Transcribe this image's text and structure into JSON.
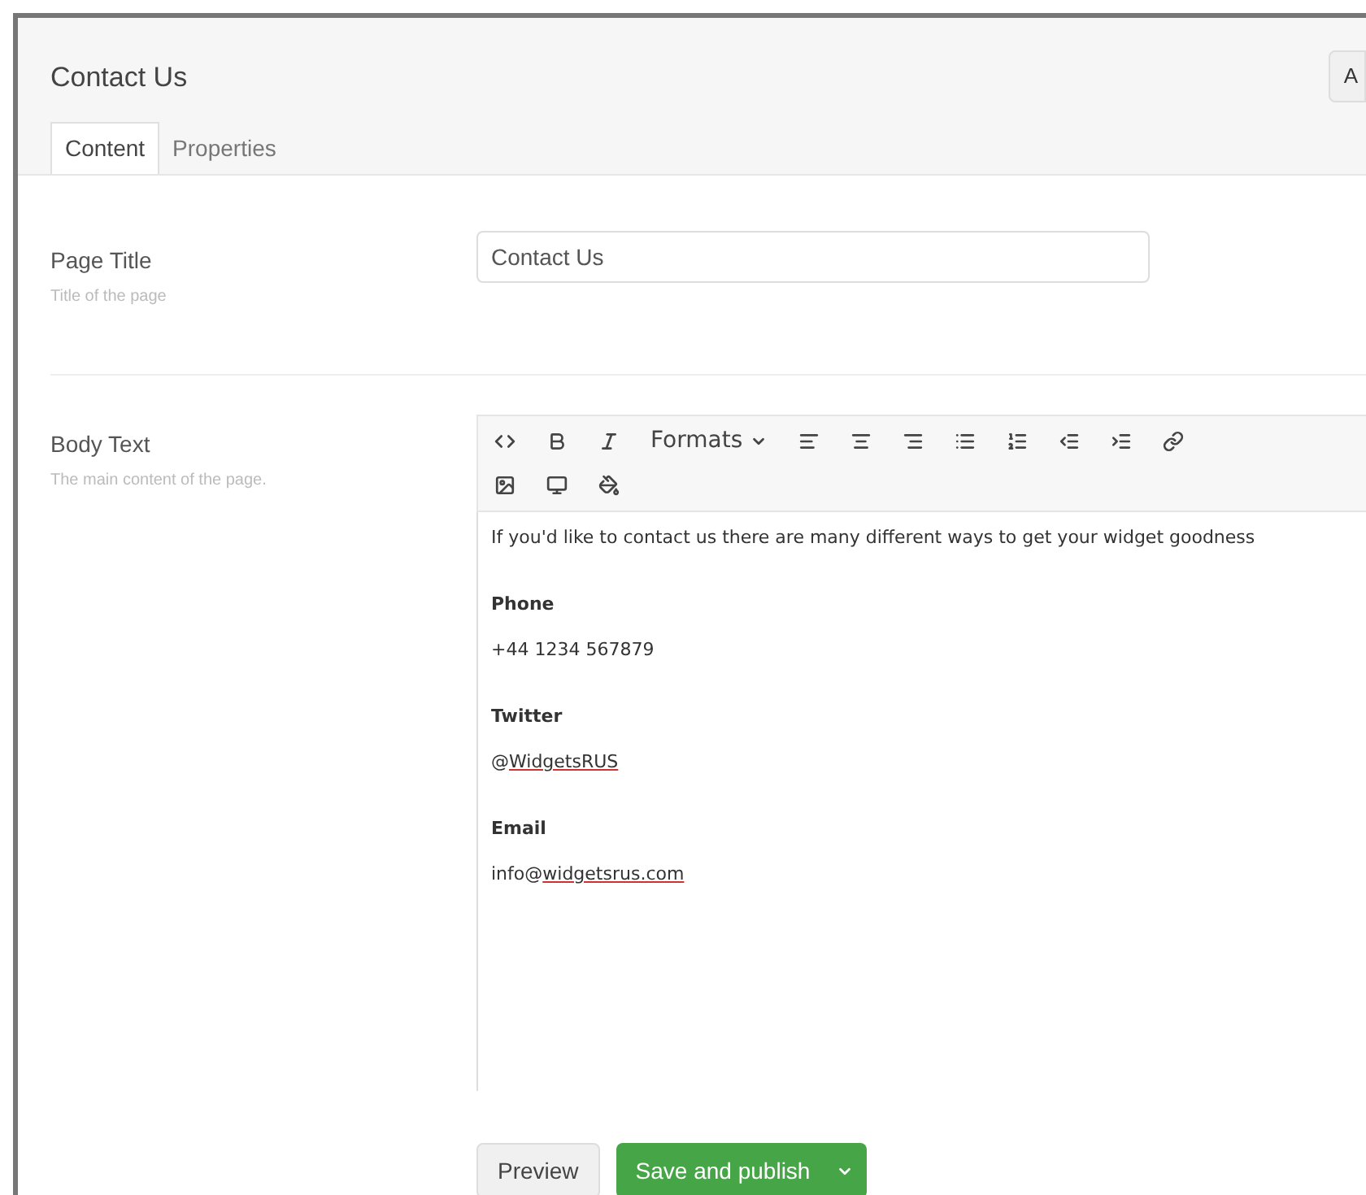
{
  "header": {
    "title": "Contact Us",
    "action_button": "A"
  },
  "tabs": [
    {
      "label": "Content",
      "selected": true
    },
    {
      "label": "Properties",
      "selected": false
    }
  ],
  "fields": [
    {
      "label": "Page Title",
      "description": "Title of the page",
      "value": "Contact Us"
    }
  ],
  "body_text": {
    "label": "Body Text",
    "description": "The main content of the page.",
    "toolbar_rows": [
      [
        {
          "kind": "code"
        },
        {
          "kind": "bold"
        },
        {
          "kind": "italic"
        },
        {
          "kind": "formats",
          "label": "Formats"
        },
        {
          "kind": "align-left"
        },
        {
          "kind": "align-center"
        },
        {
          "kind": "align-right"
        },
        {
          "kind": "bullet-list"
        },
        {
          "kind": "numbered-list"
        },
        {
          "kind": "outdent"
        },
        {
          "kind": "indent"
        },
        {
          "kind": "link"
        }
      ],
      [
        {
          "kind": "image"
        },
        {
          "kind": "embed"
        },
        {
          "kind": "fill"
        }
      ]
    ],
    "content": [
      {
        "kind": "paragraph",
        "text": "If you'd like to contact us there are many different ways to get your widget goodness"
      },
      {
        "kind": "heading",
        "text": "Phone"
      },
      {
        "kind": "paragraph",
        "text": "+44 1234 567879"
      },
      {
        "kind": "heading",
        "text": "Twitter"
      },
      {
        "kind": "link",
        "prefix": "@",
        "link": "WidgetsRUS"
      },
      {
        "kind": "heading",
        "text": "Email"
      },
      {
        "kind": "link",
        "prefix": "info@",
        "link": "widgetsrus.com"
      }
    ]
  },
  "buttons": {
    "preview": "Preview",
    "save": "Save and publish"
  }
}
